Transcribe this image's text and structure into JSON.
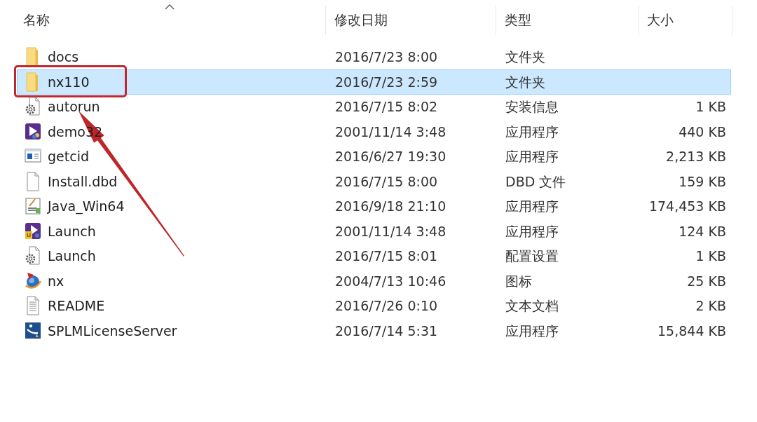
{
  "columns": [
    {
      "label": "名称",
      "sorted": true
    },
    {
      "label": "修改日期",
      "sorted": false
    },
    {
      "label": "类型",
      "sorted": false
    },
    {
      "label": "大小",
      "sorted": false
    }
  ],
  "rows": [
    {
      "kind": "folder",
      "name": "docs",
      "modified": "2016/7/23 8:00",
      "type": "文件夹",
      "selected": false,
      "highlighted": false
    },
    {
      "kind": "folder",
      "name": "nx110",
      "modified": "2016/7/23 2:59",
      "type": "文件夹",
      "selected": true,
      "highlighted": true
    },
    {
      "kind": "config",
      "name": "autorun",
      "modified": "2016/7/15 8:02",
      "type": "安装信息",
      "size": "1 KB",
      "selected": false,
      "highlighted": false
    },
    {
      "kind": "player",
      "name": "demo32",
      "modified": "2001/11/14 3:48",
      "type": "应用程序",
      "size": "440 KB",
      "selected": false,
      "highlighted": false
    },
    {
      "kind": "window",
      "name": "getcid",
      "modified": "2016/6/27 19:30",
      "type": "应用程序",
      "size": "2,213 KB",
      "selected": false,
      "highlighted": false
    },
    {
      "kind": "blank",
      "name": "Install.dbd",
      "modified": "2016/7/15 8:00",
      "type": "DBD 文件",
      "size": "159 KB",
      "selected": false,
      "highlighted": false
    },
    {
      "kind": "installer",
      "name": "Java_Win64",
      "modified": "2016/9/18 21:10",
      "type": "应用程序",
      "size": "174,453 KB",
      "selected": false,
      "highlighted": false
    },
    {
      "kind": "launcher",
      "name": "Launch",
      "modified": "2001/11/14 3:48",
      "type": "应用程序",
      "size": "124 KB",
      "selected": false,
      "highlighted": false
    },
    {
      "kind": "config",
      "name": "Launch",
      "modified": "2016/7/15 8:01",
      "type": "配置设置",
      "size": "1 KB",
      "selected": false,
      "highlighted": false
    },
    {
      "kind": "globe",
      "name": "nx",
      "modified": "2004/7/13 10:46",
      "type": "图标",
      "size": "25 KB",
      "selected": false,
      "highlighted": false
    },
    {
      "kind": "text",
      "name": "README",
      "modified": "2016/7/26 0:10",
      "type": "文本文档",
      "size": "2 KB",
      "selected": false,
      "highlighted": false
    },
    {
      "kind": "server",
      "name": "SPLMLicenseServer",
      "modified": "2016/7/14 5:31",
      "type": "应用程序",
      "size": "15,844 KB",
      "selected": false,
      "highlighted": false
    }
  ]
}
